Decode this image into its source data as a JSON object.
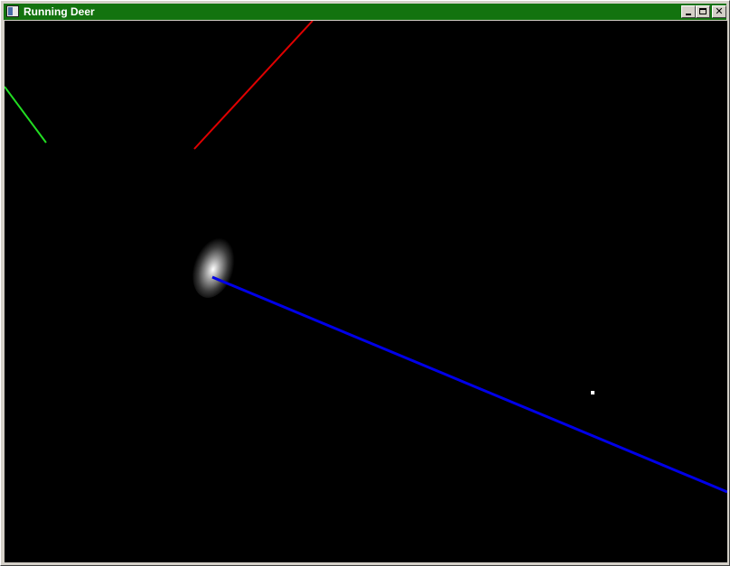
{
  "window": {
    "title": "Running Deer",
    "controls": {
      "minimize_icon": "minimize-icon",
      "maximize_icon": "maximize-icon",
      "close_glyph": "✕"
    },
    "titlebar_color": "#13730f"
  },
  "scene": {
    "background_color": "#000000",
    "line_colors": {
      "red": "#e00000",
      "green": "#22dd22",
      "blue": "#0000e8"
    },
    "point_color": "#ffffff"
  }
}
